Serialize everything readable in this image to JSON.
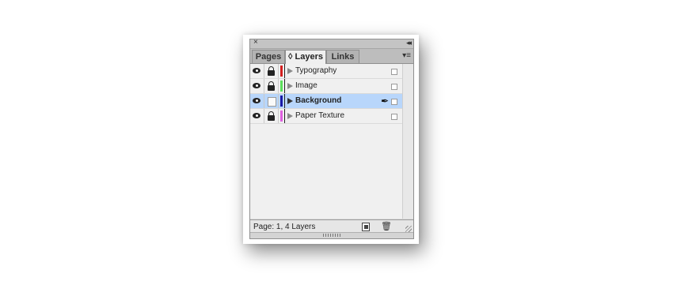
{
  "panel": {
    "tabs": [
      {
        "label": "Pages",
        "active": false
      },
      {
        "label": "◊ Layers",
        "active": true
      },
      {
        "label": "Links",
        "active": false
      }
    ],
    "close_glyph": "×",
    "collapse_glyph": "◂◂",
    "menu_glyph": "▾≡"
  },
  "layers": [
    {
      "name": "Typography",
      "visible": true,
      "locked": true,
      "color": "#d42020",
      "selected": false
    },
    {
      "name": "Image",
      "visible": true,
      "locked": true,
      "color": "#5ce05c",
      "selected": false
    },
    {
      "name": "Background",
      "visible": true,
      "locked": false,
      "color": "#1a1aa8",
      "selected": true
    },
    {
      "name": "Paper Texture",
      "visible": true,
      "locked": true,
      "color": "#e060e0",
      "selected": false
    }
  ],
  "footer": {
    "status": "Page: 1, 4 Layers",
    "trash_glyph": "🗑"
  },
  "icons": {
    "eye": "eye-icon",
    "lock": "lock-icon",
    "pen": "pen-icon",
    "pen_glyph": "✒"
  }
}
